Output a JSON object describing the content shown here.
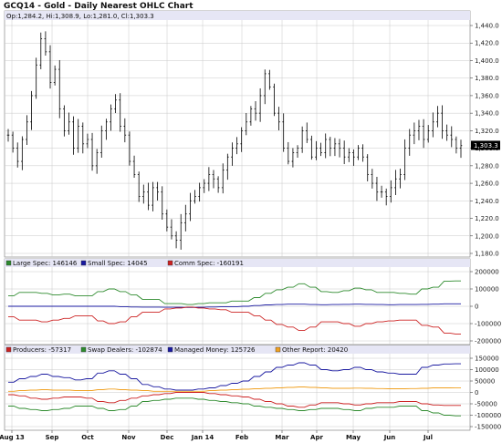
{
  "title": "GCQ14 - Gold - Daily Nearest OHLC Chart",
  "ohlc_readout": "Op:1,284.2, Hi:1,308.9, Lo:1,281.0, Cl:1,303.3",
  "last_price_label": "1,303.3",
  "colors": {
    "bar": "#000000",
    "grid": "#c8c8c8",
    "panel_header": "#e6e6f5",
    "last_price_bg": "#000000",
    "large_spec": "#2e8b2e",
    "small_spec": "#1a1aa0",
    "comm_spec": "#cc2222",
    "producers": "#cc2222",
    "swap_dealers": "#2e8b2e",
    "managed_money": "#1a1aa0",
    "other_report": "#f0a020"
  },
  "chart_data": [
    {
      "type": "ohlc",
      "title": "GCQ14 - Gold - Daily Nearest OHLC Chart",
      "ylim": [
        1180,
        1440
      ],
      "yticks": [
        "1,180.0",
        "1,200.0",
        "1,220.0",
        "1,240.0",
        "1,260.0",
        "1,280.0",
        "1,300.0",
        "1,320.0",
        "1,340.0",
        "1,360.0",
        "1,380.0",
        "1,400.0",
        "1,420.0",
        "1,440.0"
      ],
      "months": [
        "Aug 13",
        "Sep",
        "Oct",
        "Nov",
        "Dec",
        "Jan 14",
        "Feb",
        "Mar",
        "Apr",
        "May",
        "Jun",
        "Jul"
      ],
      "closes": [
        1315,
        1300,
        1285,
        1310,
        1330,
        1360,
        1395,
        1425,
        1410,
        1375,
        1390,
        1345,
        1320,
        1330,
        1300,
        1325,
        1305,
        1310,
        1280,
        1295,
        1320,
        1330,
        1345,
        1355,
        1325,
        1315,
        1285,
        1270,
        1245,
        1250,
        1235,
        1255,
        1250,
        1225,
        1210,
        1200,
        1195,
        1215,
        1225,
        1240,
        1245,
        1255,
        1260,
        1270,
        1265,
        1255,
        1275,
        1290,
        1300,
        1305,
        1320,
        1330,
        1345,
        1340,
        1360,
        1385,
        1370,
        1340,
        1330,
        1300,
        1285,
        1295,
        1300,
        1320,
        1310,
        1290,
        1300,
        1295,
        1310,
        1300,
        1305,
        1300,
        1290,
        1295,
        1290,
        1300,
        1290,
        1270,
        1260,
        1250,
        1250,
        1245,
        1255,
        1265,
        1270,
        1300,
        1315,
        1320,
        1325,
        1310,
        1320,
        1330,
        1340,
        1320,
        1315,
        1310,
        1300,
        1303
      ]
    },
    {
      "type": "line",
      "series": [
        {
          "name": "Large Spec: 146146",
          "color_key": "large_spec",
          "values": [
            60000,
            60000,
            80000,
            80000,
            80000,
            80000,
            75000,
            75000,
            65000,
            65000,
            70000,
            70000,
            60000,
            60000,
            60000,
            60000,
            85000,
            85000,
            100000,
            100000,
            85000,
            85000,
            65000,
            65000,
            40000,
            40000,
            40000,
            40000,
            15000,
            15000,
            15000,
            15000,
            10000,
            10000,
            15000,
            15000,
            20000,
            20000,
            20000,
            20000,
            30000,
            30000,
            30000,
            30000,
            50000,
            50000,
            75000,
            75000,
            95000,
            95000,
            110000,
            110000,
            130000,
            130000,
            110000,
            110000,
            85000,
            85000,
            80000,
            80000,
            90000,
            90000,
            105000,
            105000,
            95000,
            95000,
            80000,
            80000,
            80000,
            80000,
            75000,
            75000,
            70000,
            70000,
            100000,
            100000,
            110000,
            110000,
            145000,
            145000,
            146146,
            146146
          ]
        },
        {
          "name": "Small Spec: 14045",
          "color_key": "small_spec",
          "values": [
            0,
            0,
            0,
            0,
            0,
            0,
            0,
            0,
            0,
            0,
            0,
            0,
            0,
            0,
            0,
            0,
            0,
            0,
            0,
            0,
            -2000,
            -2000,
            -4000,
            -4000,
            -5000,
            -5000,
            -5000,
            -5000,
            -6000,
            -6000,
            -6000,
            -6000,
            -7000,
            -7000,
            -6000,
            -6000,
            -4000,
            -4000,
            -3000,
            -3000,
            -2000,
            -2000,
            0,
            0,
            4000,
            4000,
            8000,
            8000,
            10000,
            10000,
            12000,
            12000,
            12000,
            12000,
            10000,
            10000,
            9000,
            9000,
            10000,
            10000,
            11000,
            11000,
            12000,
            12000,
            11000,
            11000,
            10000,
            10000,
            9000,
            9000,
            10000,
            10000,
            10000,
            10000,
            11000,
            11000,
            12000,
            12000,
            14000,
            14000,
            14045,
            14045
          ]
        },
        {
          "name": "Comm Spec: -160191",
          "color_key": "comm_spec",
          "values": [
            -60000,
            -60000,
            -80000,
            -80000,
            -80000,
            -80000,
            -90000,
            -90000,
            -80000,
            -80000,
            -70000,
            -70000,
            -55000,
            -55000,
            -55000,
            -55000,
            -85000,
            -85000,
            -100000,
            -100000,
            -90000,
            -90000,
            -60000,
            -60000,
            -35000,
            -35000,
            -35000,
            -35000,
            -15000,
            -15000,
            -10000,
            -10000,
            -5000,
            -5000,
            -10000,
            -10000,
            -15000,
            -15000,
            -20000,
            -20000,
            -35000,
            -35000,
            -35000,
            -35000,
            -55000,
            -55000,
            -80000,
            -80000,
            -105000,
            -105000,
            -120000,
            -120000,
            -140000,
            -140000,
            -120000,
            -120000,
            -90000,
            -90000,
            -90000,
            -90000,
            -100000,
            -100000,
            -115000,
            -115000,
            -100000,
            -100000,
            -90000,
            -90000,
            -85000,
            -85000,
            -80000,
            -80000,
            -80000,
            -80000,
            -110000,
            -110000,
            -120000,
            -120000,
            -155000,
            -155000,
            -160191,
            -160191
          ]
        }
      ],
      "ylim": [
        -200000,
        200000
      ],
      "yticks": [
        "200000",
        "100000",
        "0",
        "-100000",
        "-200000"
      ]
    },
    {
      "type": "line",
      "series": [
        {
          "name": "Producers: -57317",
          "color_key": "producers",
          "values": [
            -10000,
            -10000,
            -15000,
            -15000,
            -25000,
            -25000,
            -30000,
            -30000,
            -25000,
            -25000,
            -20000,
            -20000,
            -20000,
            -20000,
            -25000,
            -25000,
            -40000,
            -40000,
            -45000,
            -45000,
            -35000,
            -35000,
            -25000,
            -25000,
            -15000,
            -15000,
            -10000,
            -10000,
            -5000,
            -5000,
            0,
            0,
            0,
            0,
            0,
            0,
            -5000,
            -5000,
            -10000,
            -10000,
            -15000,
            -15000,
            -20000,
            -20000,
            -30000,
            -30000,
            -40000,
            -40000,
            -50000,
            -50000,
            -60000,
            -60000,
            -65000,
            -65000,
            -55000,
            -55000,
            -45000,
            -45000,
            -45000,
            -45000,
            -50000,
            -50000,
            -55000,
            -55000,
            -50000,
            -50000,
            -45000,
            -45000,
            -45000,
            -45000,
            -40000,
            -40000,
            -40000,
            -40000,
            -50000,
            -50000,
            -55000,
            -55000,
            -57000,
            -57000,
            -57317,
            -57317
          ]
        },
        {
          "name": "Swap Dealers: -102874",
          "color_key": "swap_dealers",
          "values": [
            -60000,
            -60000,
            -70000,
            -70000,
            -75000,
            -75000,
            -80000,
            -80000,
            -75000,
            -75000,
            -70000,
            -70000,
            -60000,
            -60000,
            -60000,
            -60000,
            -70000,
            -70000,
            -80000,
            -80000,
            -75000,
            -75000,
            -60000,
            -60000,
            -40000,
            -40000,
            -35000,
            -35000,
            -30000,
            -30000,
            -25000,
            -25000,
            -25000,
            -25000,
            -30000,
            -30000,
            -35000,
            -35000,
            -40000,
            -40000,
            -45000,
            -45000,
            -50000,
            -50000,
            -60000,
            -60000,
            -65000,
            -65000,
            -70000,
            -70000,
            -75000,
            -75000,
            -80000,
            -80000,
            -75000,
            -75000,
            -70000,
            -70000,
            -70000,
            -70000,
            -75000,
            -75000,
            -80000,
            -80000,
            -70000,
            -70000,
            -65000,
            -65000,
            -65000,
            -65000,
            -60000,
            -60000,
            -60000,
            -60000,
            -80000,
            -80000,
            -90000,
            -90000,
            -100000,
            -100000,
            -102874,
            -102874
          ]
        },
        {
          "name": "Managed Money: 125726",
          "color_key": "managed_money",
          "values": [
            45000,
            45000,
            60000,
            60000,
            70000,
            70000,
            80000,
            80000,
            70000,
            70000,
            65000,
            65000,
            55000,
            55000,
            60000,
            60000,
            85000,
            85000,
            95000,
            95000,
            80000,
            80000,
            60000,
            60000,
            35000,
            35000,
            25000,
            25000,
            15000,
            15000,
            10000,
            10000,
            10000,
            10000,
            15000,
            15000,
            20000,
            20000,
            30000,
            30000,
            40000,
            40000,
            50000,
            50000,
            70000,
            70000,
            90000,
            90000,
            110000,
            110000,
            120000,
            120000,
            130000,
            130000,
            120000,
            120000,
            100000,
            100000,
            95000,
            95000,
            100000,
            100000,
            110000,
            110000,
            100000,
            100000,
            90000,
            90000,
            85000,
            85000,
            80000,
            80000,
            80000,
            80000,
            110000,
            110000,
            120000,
            120000,
            125000,
            125000,
            125726,
            125726
          ]
        },
        {
          "name": "Other Report: 20420",
          "color_key": "other_report",
          "values": [
            5000,
            5000,
            8000,
            8000,
            10000,
            10000,
            12000,
            12000,
            10000,
            10000,
            10000,
            10000,
            8000,
            8000,
            8000,
            8000,
            12000,
            12000,
            15000,
            15000,
            12000,
            12000,
            10000,
            10000,
            8000,
            8000,
            5000,
            5000,
            5000,
            5000,
            5000,
            5000,
            5000,
            5000,
            5000,
            5000,
            8000,
            8000,
            10000,
            10000,
            12000,
            12000,
            14000,
            14000,
            16000,
            16000,
            18000,
            18000,
            20000,
            20000,
            22000,
            22000,
            24000,
            24000,
            22000,
            22000,
            20000,
            20000,
            18000,
            18000,
            18000,
            18000,
            19000,
            19000,
            18000,
            18000,
            17000,
            17000,
            16000,
            16000,
            16000,
            16000,
            17000,
            17000,
            18000,
            18000,
            20000,
            20000,
            20000,
            20000,
            20420,
            20420
          ]
        }
      ],
      "ylim": [
        -150000,
        150000
      ],
      "yticks": [
        "150000",
        "100000",
        "50000",
        "0",
        "-50000",
        "-100000",
        "-150000"
      ]
    }
  ]
}
